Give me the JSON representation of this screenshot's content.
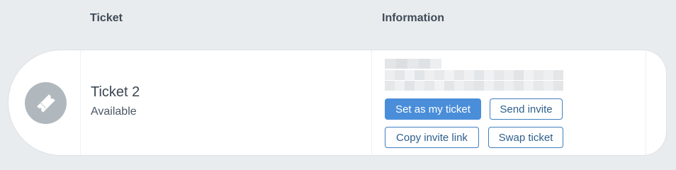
{
  "table": {
    "headers": {
      "ticket": "Ticket",
      "information": "Information"
    }
  },
  "ticket": {
    "name": "Ticket 2",
    "status": "Available",
    "icon": "ticket-icon",
    "info_redacted": true
  },
  "actions": {
    "set_as_my_ticket": "Set as my ticket",
    "send_invite": "Send invite",
    "copy_invite_link": "Copy invite link",
    "swap_ticket": "Swap ticket"
  },
  "colors": {
    "background": "#e9ecee",
    "card": "#ffffff",
    "icon_circle": "#b0b8bd",
    "primary_button": "#4a8ed9",
    "outline_button_border": "#3f7fbf",
    "outline_button_text": "#2e5f8c"
  }
}
